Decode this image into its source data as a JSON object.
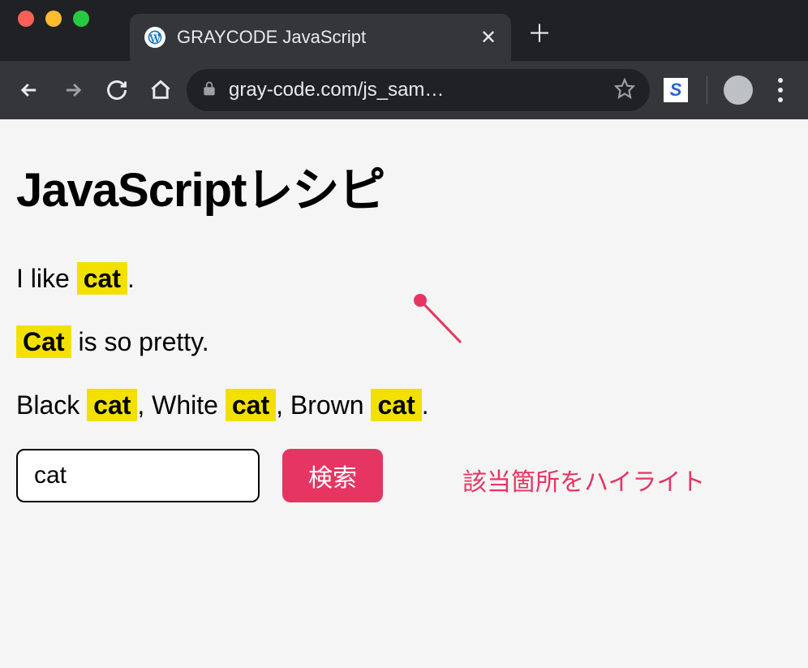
{
  "browser": {
    "tab_title": "GRAYCODE JavaScript",
    "url_display": "gray-code.com/js_sam…"
  },
  "page": {
    "title": "JavaScriptレシピ",
    "line1_pre": "I like ",
    "line1_hl": "cat",
    "line1_post": ".",
    "line2_hl": "Cat",
    "line2_post": " is so pretty.",
    "line3_p1": "Black ",
    "line3_h1": "cat",
    "line3_p2": ", White ",
    "line3_h2": "cat",
    "line3_p3": ", Brown ",
    "line3_h3": "cat",
    "line3_p4": ".",
    "search_value": "cat",
    "search_button": "検索",
    "annotation": "該当箇所をハイライト"
  }
}
